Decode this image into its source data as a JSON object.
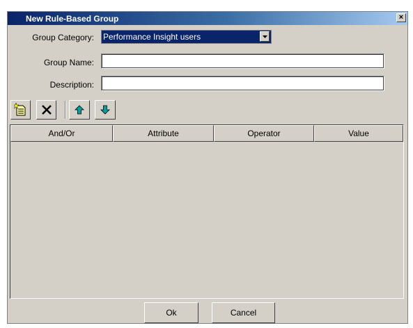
{
  "dialog": {
    "title": "New Rule-Based Group",
    "close_label": "×"
  },
  "form": {
    "category_label": "Group Category:",
    "category_value": "Performance Insight users",
    "name_label": "Group Name:",
    "name_value": "",
    "description_label": "Description:",
    "description_value": ""
  },
  "toolbar": {
    "items": [
      "new-rule-icon",
      "delete-icon",
      "move-up-icon",
      "move-down-icon"
    ],
    "icon_colors": {
      "arrows": "#00a0a0",
      "page": "#ffffa0"
    }
  },
  "table": {
    "columns": [
      "And/Or",
      "Attribute",
      "Operator",
      "Value"
    ],
    "rows": []
  },
  "buttons": {
    "ok": "Ok",
    "cancel": "Cancel"
  },
  "colors": {
    "title_bar": "#0a246a",
    "face": "#d4d0c8",
    "selection": "#0a246a"
  }
}
